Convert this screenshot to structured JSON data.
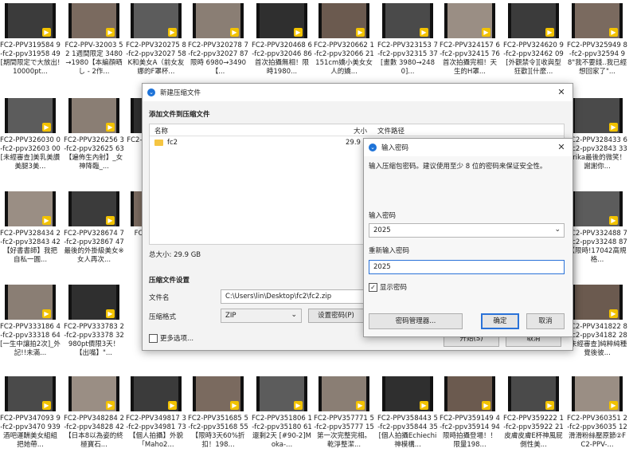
{
  "tiles": [
    {
      "label": "FC2-PPV319584 9-fc2-ppv31958 49[期間限定で大放出!10000pt..."
    },
    {
      "label": "FC2-PPV-32003 52 1週間限定 3480→1980【本編顔晒し - 2作..."
    },
    {
      "label": "FC2-PPV320275 8-fc2-ppv32027 58K和美女A（前女友娜的F罩杯..."
    },
    {
      "label": "FC2-PPV320278 7-fc2-ppv32027 87限時 6980→3490【..."
    },
    {
      "label": "FC2-PPV320468 6-fc2-ppv32046 86首次拍攝無相！限時1980..."
    },
    {
      "label": "FC2-PPV320662 1-fc2-ppv32066 21151cm嬌小美女女人的嬌..."
    },
    {
      "label": "FC2-PPV323153 7-fc2-ppv32315 37[畫數 3980→2480]..."
    },
    {
      "label": "FC2-PPV324157 6-fc2-ppv32415 76首次拍攝完相！天生的H罩..."
    },
    {
      "label": "FC2-PPV324620 9-fc2-ppv32462 09[外觀禁令][收與型狂歡][什麼..."
    },
    {
      "label": "FC2-PPV325949 8-fc2-ppv32594 98\"我不要錢..我已經想回家了\"..."
    },
    {
      "label": "FC2-PPV326030 0-fc2-ppv32603 00[未經審查]美乳美讚美腿3美..."
    },
    {
      "label": "FC2-PPV326256 3-fc2-ppv32625 63【遍佈生內射】_女神降臨_..."
    },
    {
      "label": "FC2-PPV 625 達..."
    },
    {
      "label": "FC2-PPV 320 天..."
    },
    {
      "label": "FC2-PPV328433 6-fc2-ppv32843 33Erika最後的微笑！謝謝你..."
    },
    {
      "label": "FC2-PPV328434 2-fc2-ppv32843 42【好書書師】我把自私一圓..."
    },
    {
      "label": "FC2-PPV328674 7-fc2-ppv32867 47最後的外掛級美女※女人再次..."
    },
    {
      "label": "FC2-PPV 出..."
    },
    {
      "label": "FC2-PPV332488 7-fc2-ppv33248 87【限時!17042高規格..."
    },
    {
      "label": "FC2-PPV333186 4-fc2-ppv33318 64[一生中讓拍2次]_外記!!未滿..."
    },
    {
      "label": "FC2-PPV333783 2-fc2-ppv33378 32980pt價限3天！【出嘴】\"..."
    },
    {
      "label": "FC2-PPV341822 8-fc2-ppv34182 28[未經審查]純粹純種覺後彼..."
    },
    {
      "label": "FC2-PPV347093 9-fc2-ppv3470 939酒吧運酬美女組組把她帶..."
    },
    {
      "label": "FC2-PPV348284 2-fc2-ppv34828 42【日本8以為姿的終極寶石..."
    },
    {
      "label": "FC2-PPV349817 3-fc2-ppv34981 73【個人拍攝】外貌「Maho2..."
    },
    {
      "label": "FC2-PPV351685 5-fc2-ppv35168 55【限時3天60%折扣！198..."
    },
    {
      "label": "FC2-PPV351806 1-fc2-ppv35180 61還剩2天 [#90-2]Moka-..."
    },
    {
      "label": "FC2-PPV357771 5-fc2-ppv35777 15第一次完整完相。乾淨整潔..."
    },
    {
      "label": "FC2-PPV358443 5-fc2-ppv35844 35[個人拍攝Echiechi神模構..."
    },
    {
      "label": "FC2-PPV359149 4-fc2-ppv35914 94限時拍攝登場！！限量198..."
    },
    {
      "label": "FC2-PPV359222 1-fc2-ppv35922 21皮膚皮膚E杯神風屁側性美..."
    },
    {
      "label": "FC2-PPV360351 2-fc2-ppv36035 12滑滑粉絲壓原節②FC2-PPV-..."
    }
  ],
  "archive_dialog": {
    "title": "新建压缩文件",
    "section_add": "添加文件到压缩文件",
    "col_name": "名称",
    "col_size": "大小",
    "col_path": "文件路径",
    "file_row": {
      "name": "fc2",
      "size": "29.9 GB"
    },
    "total_size": "总大小: 29.9 GB",
    "section_settings": "压缩文件设置",
    "filename_label": "文件名",
    "filename_value": "C:\\Users\\lin\\Desktop\\fc2\\fc2.zip",
    "format_label": "压缩格式",
    "format_value": "ZIP",
    "password_button": "设置密码(P)",
    "more_options": "更多选项...",
    "start_button": "开始(S)",
    "cancel_button": "取消"
  },
  "password_dialog": {
    "title": "输入密码",
    "hint": "输入压缩包密码。建议使用至少 8 位的密码来保证安全性。",
    "enter_label": "输入密码",
    "enter_value": "2025",
    "reenter_label": "重新输入密码",
    "reenter_value": "2025",
    "show_password": "显示密码",
    "manager_button": "密码管理器...",
    "ok_button": "确定",
    "cancel_button": "取消"
  },
  "colors": {
    "accent": "#1e73d8",
    "badge": "#f2c200"
  }
}
